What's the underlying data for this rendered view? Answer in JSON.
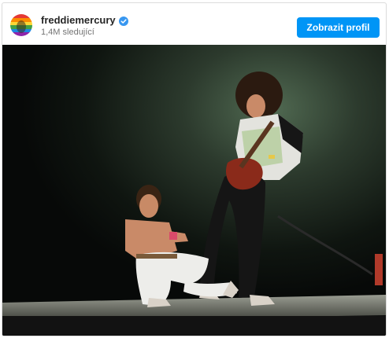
{
  "post": {
    "username": "freddiemercury",
    "followers": "1,4M sledující",
    "profile_button_label": "Zobrazit profil",
    "verified": true,
    "colors": {
      "accent": "#0095f6",
      "verified_badge": "#3897f0"
    }
  }
}
